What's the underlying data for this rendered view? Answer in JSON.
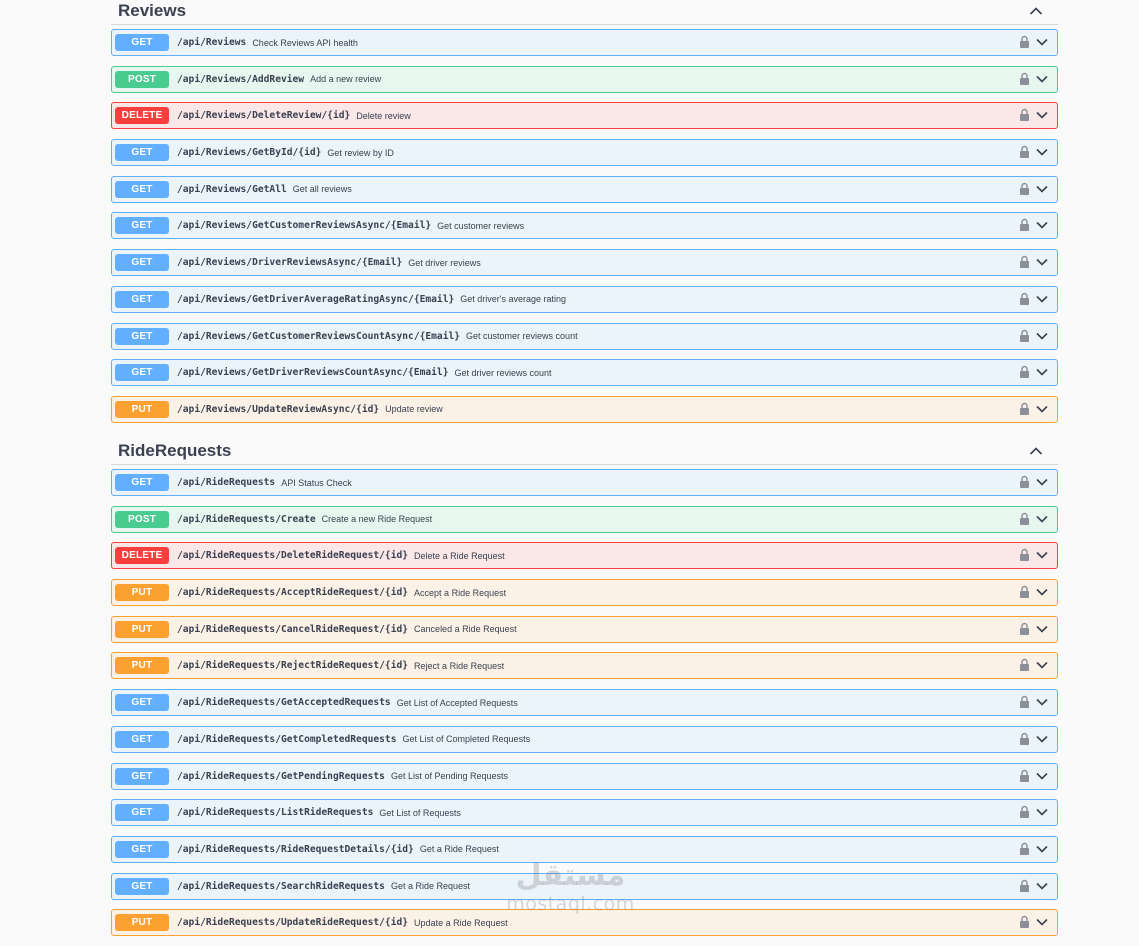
{
  "sections": [
    {
      "title": "Reviews",
      "operations": [
        {
          "method": "GET",
          "path": "/api/Reviews",
          "summary": "Check Reviews API health"
        },
        {
          "method": "POST",
          "path": "/api/Reviews/AddReview",
          "summary": "Add a new review"
        },
        {
          "method": "DELETE",
          "path": "/api/Reviews/DeleteReview/{id}",
          "summary": "Delete review"
        },
        {
          "method": "GET",
          "path": "/api/Reviews/GetById/{id}",
          "summary": "Get review by ID"
        },
        {
          "method": "GET",
          "path": "/api/Reviews/GetAll",
          "summary": "Get all reviews"
        },
        {
          "method": "GET",
          "path": "/api/Reviews/GetCustomerReviewsAsync/{Email}",
          "summary": "Get customer reviews"
        },
        {
          "method": "GET",
          "path": "/api/Reviews/DriverReviewsAsync/{Email}",
          "summary": "Get driver reviews"
        },
        {
          "method": "GET",
          "path": "/api/Reviews/GetDriverAverageRatingAsync/{Email}",
          "summary": "Get driver's average rating"
        },
        {
          "method": "GET",
          "path": "/api/Reviews/GetCustomerReviewsCountAsync/{Email}",
          "summary": "Get customer reviews count"
        },
        {
          "method": "GET",
          "path": "/api/Reviews/GetDriverReviewsCountAsync/{Email}",
          "summary": "Get driver reviews count"
        },
        {
          "method": "PUT",
          "path": "/api/Reviews/UpdateReviewAsync/{id}",
          "summary": "Update review"
        }
      ]
    },
    {
      "title": "RideRequests",
      "operations": [
        {
          "method": "GET",
          "path": "/api/RideRequests",
          "summary": "API Status Check"
        },
        {
          "method": "POST",
          "path": "/api/RideRequests/Create",
          "summary": "Create a new Ride Request"
        },
        {
          "method": "DELETE",
          "path": "/api/RideRequests/DeleteRideRequest/{id}",
          "summary": "Delete a Ride Request"
        },
        {
          "method": "PUT",
          "path": "/api/RideRequests/AcceptRideRequest/{id}",
          "summary": "Accept a Ride Request"
        },
        {
          "method": "PUT",
          "path": "/api/RideRequests/CancelRideRequest/{id}",
          "summary": "Canceled a Ride Request"
        },
        {
          "method": "PUT",
          "path": "/api/RideRequests/RejectRideRequest/{id}",
          "summary": "Reject a Ride Request"
        },
        {
          "method": "GET",
          "path": "/api/RideRequests/GetAcceptedRequests",
          "summary": "Get List of Accepted Requests"
        },
        {
          "method": "GET",
          "path": "/api/RideRequests/GetCompletedRequests",
          "summary": "Get List of Completed Requests"
        },
        {
          "method": "GET",
          "path": "/api/RideRequests/GetPendingRequests",
          "summary": "Get List of Pending Requests"
        },
        {
          "method": "GET",
          "path": "/api/RideRequests/ListRideRequests",
          "summary": "Get List of Requests"
        },
        {
          "method": "GET",
          "path": "/api/RideRequests/RideRequestDetails/{id}",
          "summary": "Get a Ride Request"
        },
        {
          "method": "GET",
          "path": "/api/RideRequests/SearchRideRequests",
          "summary": "Get a Ride Request"
        },
        {
          "method": "PUT",
          "path": "/api/RideRequests/UpdateRideRequest/{id}",
          "summary": "Update a Ride Request"
        }
      ]
    }
  ],
  "icons": {
    "lock": "lock-icon",
    "expand": "chevron-down-icon",
    "collapse": "chevron-up-icon"
  },
  "colors": {
    "get": "#61affe",
    "post": "#49cc90",
    "delete": "#f93e3e",
    "put": "#fca130"
  },
  "watermark": {
    "arabic": "مستقل",
    "latin": "mostaql.com"
  }
}
